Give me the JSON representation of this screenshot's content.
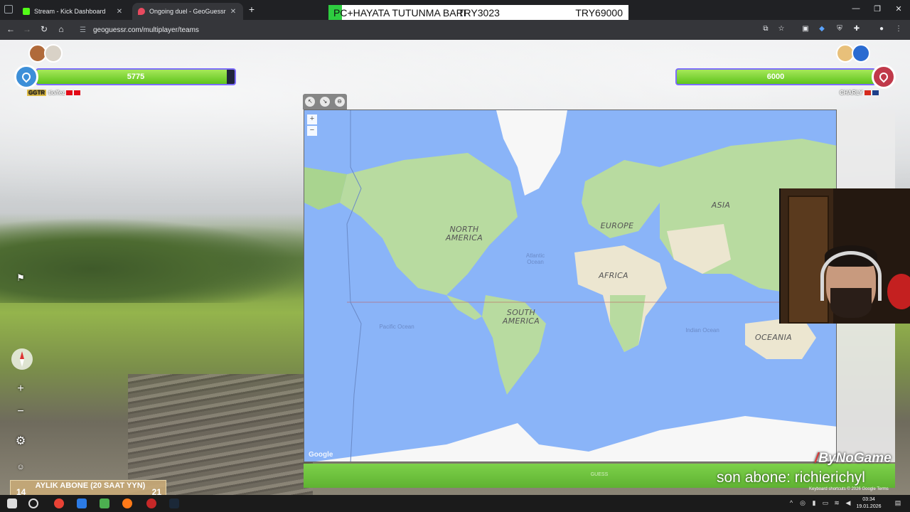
{
  "browser": {
    "tabs": [
      {
        "title": "Stream - Kick Dashboard",
        "active": false
      },
      {
        "title": "Ongoing duel - GeoGuessr",
        "active": true
      }
    ],
    "url": "geoguessr.com/multiplayer/teams"
  },
  "donation_bar": {
    "label": "PC+HAYATA TUTUNMA BARI",
    "current": "TRY3023",
    "goal": "TRY69000",
    "progress_fraction": 0.044
  },
  "left_team": {
    "score": "5775",
    "health_fraction": 0.96,
    "tag": "GGTR",
    "players": "tio/fez",
    "pin_color": "#3d8fd8"
  },
  "right_team": {
    "score": "6000",
    "health_fraction": 1.0,
    "players": "CHARLY",
    "pin_color": "#c0394a"
  },
  "map": {
    "labels": {
      "north_america": "NORTH AMERICA",
      "south_america": "SOUTH AMERICA",
      "europe": "EUROPE",
      "africa": "AFRICA",
      "asia": "ASIA",
      "oceania": "OCEANIA"
    },
    "oceans": {
      "atlantic": "Atlantic Ocean",
      "pacific": "Pacific Ocean",
      "indian": "Indian Ocean"
    },
    "zoom_in": "+",
    "zoom_out": "−",
    "logo": "Google",
    "attribution": "Keyboard shortcuts   © 2026 Google   Terms"
  },
  "guess_button": {
    "label": "GUESS"
  },
  "stream_overlay": {
    "sub_left": "14",
    "sub_title": "AYLIK ABONE (20 SAAT YYN)",
    "sub_right": "21",
    "brand": "ByNoGame",
    "last_sub": "son abone: richierichyl"
  },
  "taskbar": {
    "time": "03:34",
    "date": "19.01.2026"
  },
  "colors": {
    "donation_fill": "#2ecc40",
    "health_green": "#6fd22a",
    "water": "#8ab4f8",
    "land": "#b8dba0"
  }
}
